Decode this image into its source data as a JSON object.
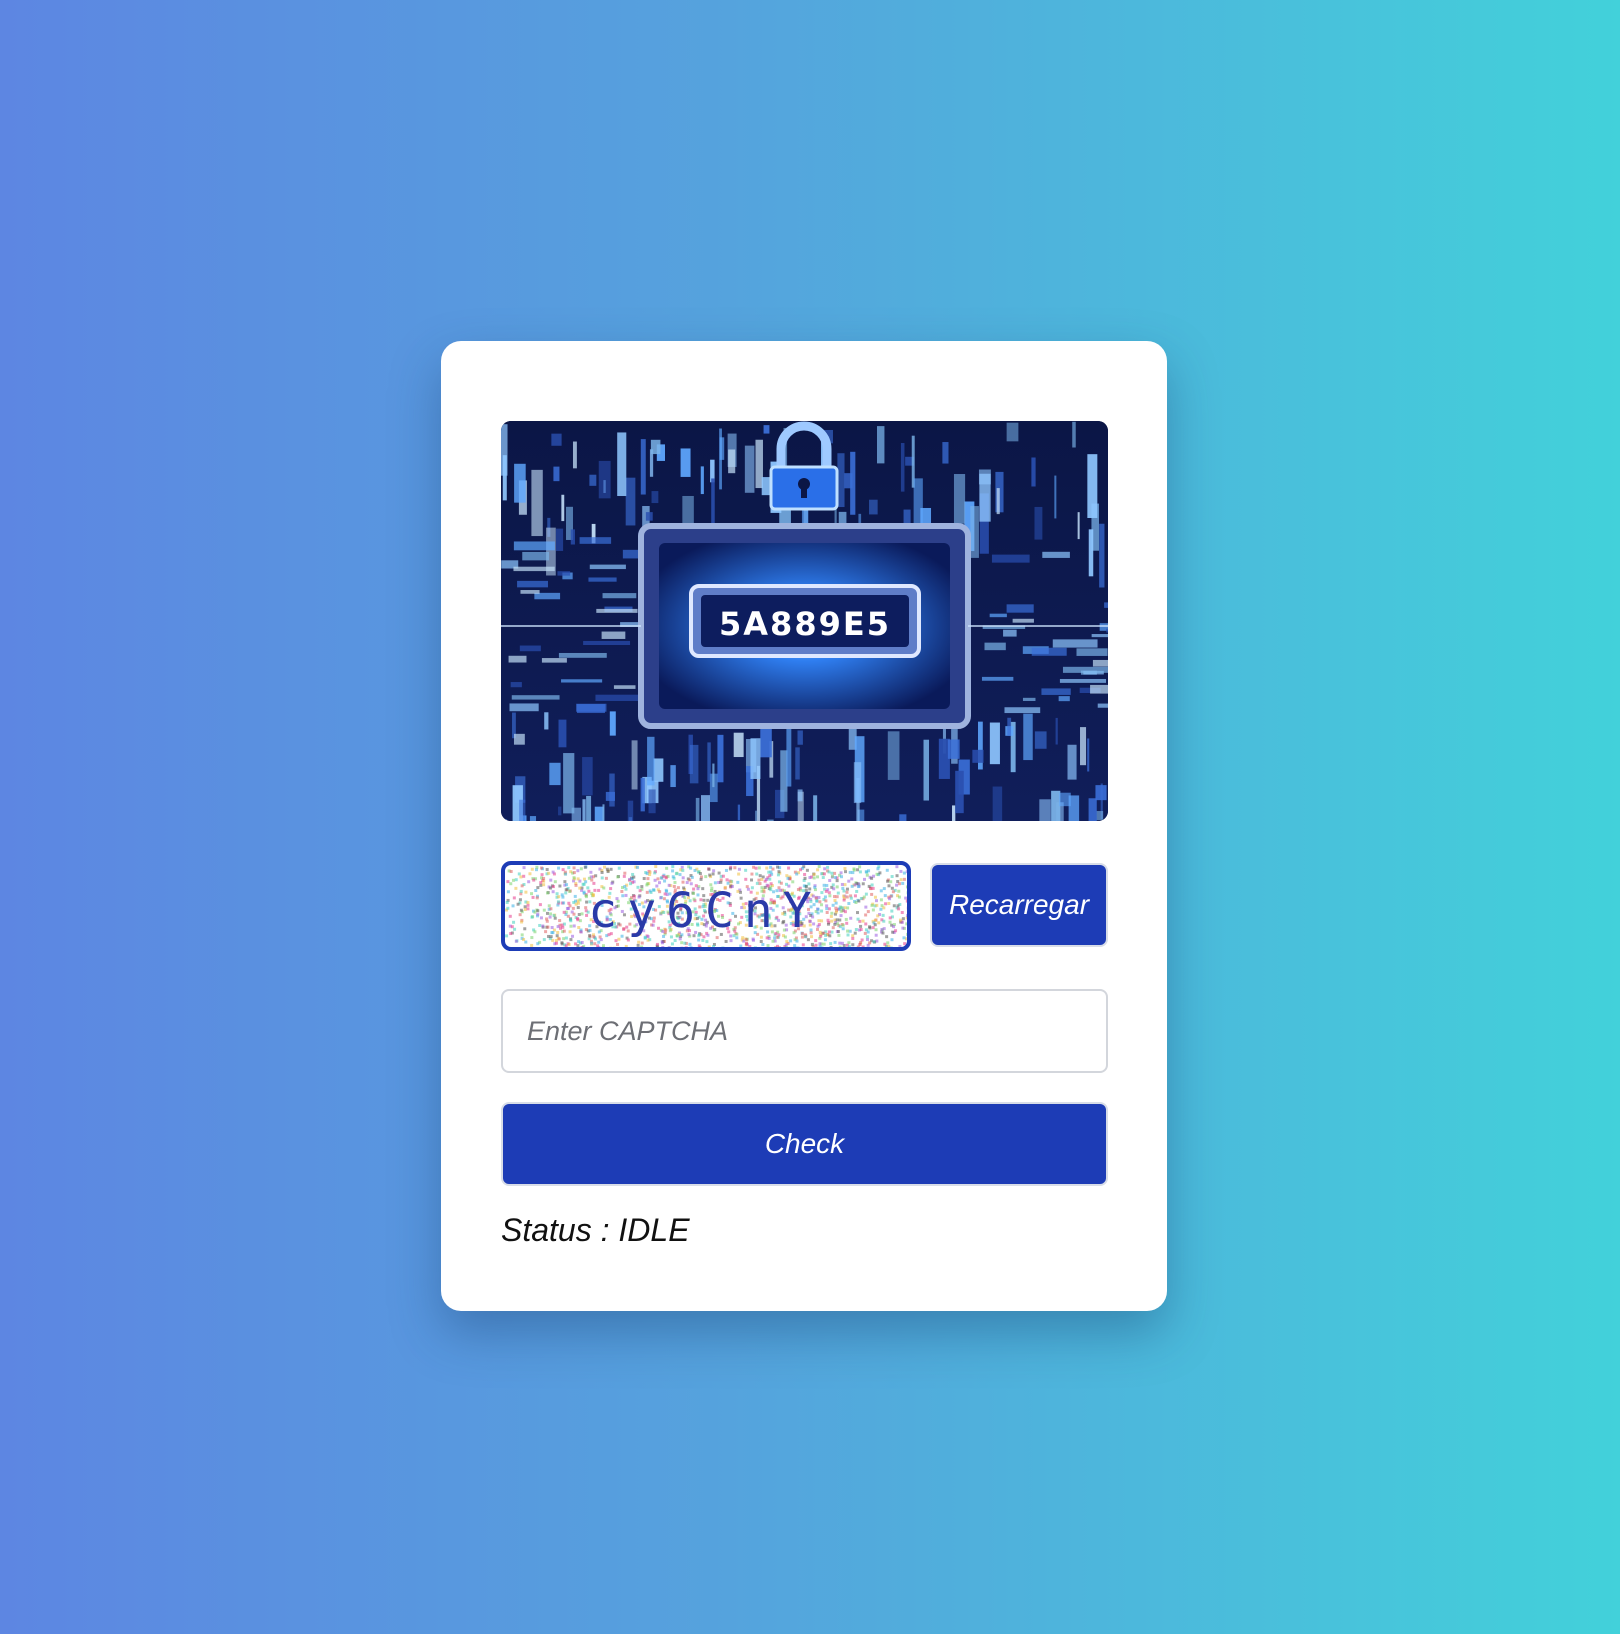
{
  "hero_image": {
    "code_text": "5A889E5"
  },
  "captcha": {
    "text": "cy6CnY",
    "reload_label": "Recarregar"
  },
  "form": {
    "input_value": "",
    "input_placeholder": "Enter CAPTCHA",
    "check_label": "Check"
  },
  "status": {
    "text": "Status : IDLE"
  },
  "colors": {
    "primary": "#1d3cb6",
    "background_start": "#5d86e2",
    "background_end": "#42d1da"
  }
}
